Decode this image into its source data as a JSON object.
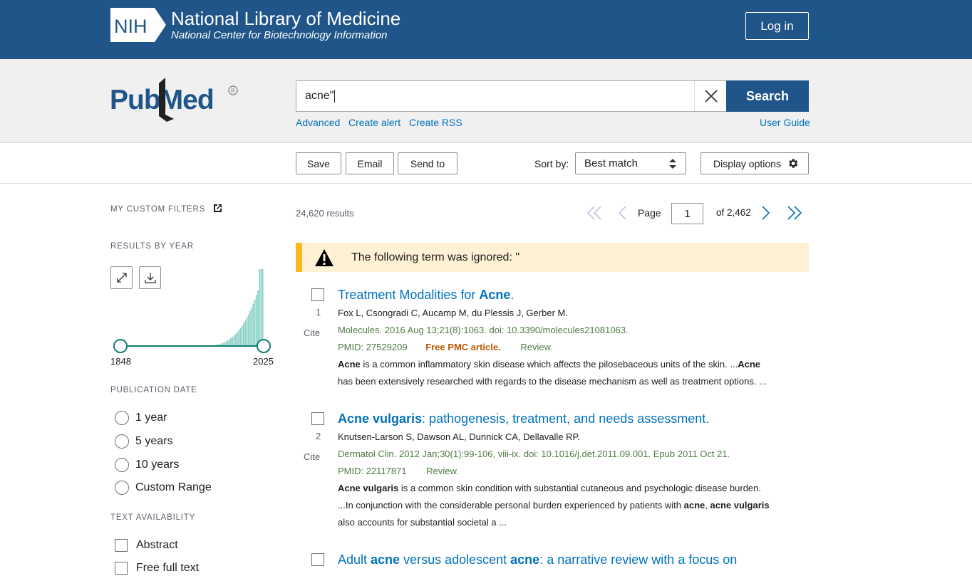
{
  "header": {
    "nih_logo_text": "NIH",
    "title": "National Library of Medicine",
    "subtitle": "National Center for Biotechnology Information",
    "login_label": "Log in"
  },
  "search": {
    "logo_text": "PubMed",
    "query": "acne\"",
    "search_label": "Search",
    "links": [
      "Advanced",
      "Create alert",
      "Create RSS"
    ],
    "user_guide": "User Guide"
  },
  "toolbar": {
    "save": "Save",
    "email": "Email",
    "send_to": "Send to",
    "sort_label": "Sort by:",
    "sort_value": "Best match",
    "display_options": "Display options"
  },
  "sidebar": {
    "custom_filters": "MY CUSTOM FILTERS",
    "results_by_year": "RESULTS BY YEAR",
    "year_start": "1848",
    "year_end": "2025",
    "publication_date": "PUBLICATION DATE",
    "date_options": [
      "1 year",
      "5 years",
      "10 years",
      "Custom Range"
    ],
    "text_availability": "TEXT AVAILABILITY",
    "text_options": [
      "Abstract",
      "Free full text"
    ],
    "colors": {
      "histogram": "#8fd3c8",
      "slider": "#0f7e74"
    }
  },
  "results": {
    "count": "24,620 results",
    "page_label": "Page",
    "page": "1",
    "of_pages": "of 2,462",
    "notice": "The following term was ignored: \"",
    "cite_label": "Cite",
    "items": [
      {
        "num": "1",
        "title_parts": [
          "Treatment Modalities for ",
          "Acne",
          "."
        ],
        "authors": "Fox L, Csongradi C, Aucamp M, du Plessis J, Gerber M.",
        "citation": "Molecules. 2016 Aug 13;21(8):1063. doi: 10.3390/molecules21081063.",
        "pmid": "PMID: 27529209",
        "free": "Free PMC article.",
        "type": "Review.",
        "snippet1_parts": [
          "Acne",
          " is a common inflammatory skin disease which affects the pilosebaceous units of the skin. ...",
          "Acne"
        ],
        "snippet2": "has been extensively researched with regards to the disease mechanism as well as treatment options. ..."
      },
      {
        "num": "2",
        "title_parts": [
          "Acne vulgaris",
          ": pathogenesis, treatment, and needs assessment."
        ],
        "authors": "Knutsen-Larson S, Dawson AL, Dunnick CA, Dellavalle RP.",
        "citation": "Dermatol Clin. 2012 Jan;30(1):99-106, viii-ix. doi: 10.1016/j.det.2011.09.001. Epub 2011 Oct 21.",
        "pmid": "PMID: 22117871",
        "type": "Review.",
        "snippet1_parts": [
          "Acne vulgaris",
          " is a common skin condition with substantial cutaneous and psychologic disease burden."
        ],
        "snippet2_parts": [
          "...In conjunction with the considerable personal burden experienced by patients with ",
          "acne",
          ", ",
          "acne vulgaris"
        ],
        "snippet3": "also accounts for substantial societal a ..."
      },
      {
        "num": "3",
        "title_parts": [
          "Adult ",
          "acne",
          " versus adolescent ",
          "acne",
          ": a narrative review with a focus on"
        ]
      }
    ]
  }
}
